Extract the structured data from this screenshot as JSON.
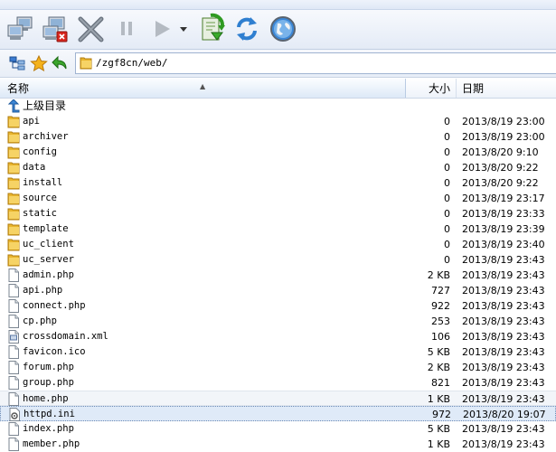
{
  "address": {
    "path": "/zgf8cn/web/"
  },
  "toolbar": {
    "buttons": [
      {
        "icon": "connect-computers-icon"
      },
      {
        "icon": "disconnect-computer-icon"
      },
      {
        "icon": "cancel-x-icon"
      },
      {
        "icon": "pause-icon"
      },
      {
        "icon": "play-icon"
      },
      {
        "icon": "dropdown-arrow-icon"
      },
      {
        "icon": "download-queue-icon"
      },
      {
        "icon": "refresh-icon"
      },
      {
        "icon": "globe-icon"
      }
    ]
  },
  "columns": {
    "name": "名称",
    "size": "大小",
    "date": "日期"
  },
  "parent_label": "上级目录",
  "files": [
    {
      "name": "api",
      "type": "folder",
      "size": "0",
      "date": "2013/8/19 23:00"
    },
    {
      "name": "archiver",
      "type": "folder",
      "size": "0",
      "date": "2013/8/19 23:00"
    },
    {
      "name": "config",
      "type": "folder",
      "size": "0",
      "date": "2013/8/20 9:10"
    },
    {
      "name": "data",
      "type": "folder",
      "size": "0",
      "date": "2013/8/20 9:22"
    },
    {
      "name": "install",
      "type": "folder",
      "size": "0",
      "date": "2013/8/20 9:22"
    },
    {
      "name": "source",
      "type": "folder",
      "size": "0",
      "date": "2013/8/19 23:17"
    },
    {
      "name": "static",
      "type": "folder",
      "size": "0",
      "date": "2013/8/19 23:33"
    },
    {
      "name": "template",
      "type": "folder",
      "size": "0",
      "date": "2013/8/19 23:39"
    },
    {
      "name": "uc_client",
      "type": "folder",
      "size": "0",
      "date": "2013/8/19 23:40"
    },
    {
      "name": "uc_server",
      "type": "folder",
      "size": "0",
      "date": "2013/8/19 23:43"
    },
    {
      "name": "admin.php",
      "type": "file",
      "size": "2 KB",
      "date": "2013/8/19 23:43"
    },
    {
      "name": "api.php",
      "type": "file",
      "size": "727",
      "date": "2013/8/19 23:43"
    },
    {
      "name": "connect.php",
      "type": "file",
      "size": "922",
      "date": "2013/8/19 23:43"
    },
    {
      "name": "cp.php",
      "type": "file",
      "size": "253",
      "date": "2013/8/19 23:43"
    },
    {
      "name": "crossdomain.xml",
      "type": "xml",
      "size": "106",
      "date": "2013/8/19 23:43"
    },
    {
      "name": "favicon.ico",
      "type": "file",
      "size": "5 KB",
      "date": "2013/8/19 23:43"
    },
    {
      "name": "forum.php",
      "type": "file",
      "size": "2 KB",
      "date": "2013/8/19 23:43"
    },
    {
      "name": "group.php",
      "type": "file",
      "size": "821",
      "date": "2013/8/19 23:43"
    },
    {
      "name": "home.php",
      "type": "file",
      "size": "1 KB",
      "date": "2013/8/19 23:43",
      "state": "hover"
    },
    {
      "name": "httpd.ini",
      "type": "ini",
      "size": "972",
      "date": "2013/8/20 19:07",
      "state": "selected"
    },
    {
      "name": "index.php",
      "type": "file",
      "size": "5 KB",
      "date": "2013/8/19 23:43"
    },
    {
      "name": "member.php",
      "type": "file",
      "size": "1 KB",
      "date": "2013/8/19 23:43"
    }
  ]
}
